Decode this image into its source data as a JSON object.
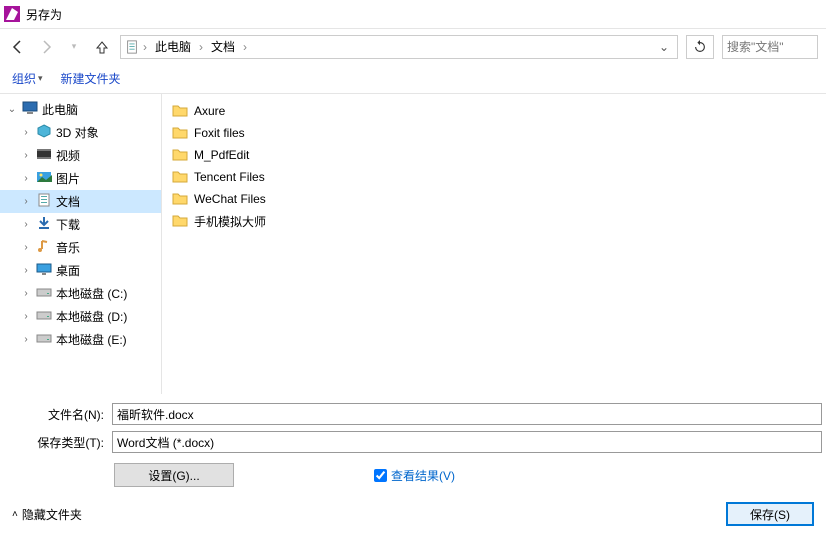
{
  "window": {
    "title": "另存为"
  },
  "breadcrumb": {
    "items": [
      "此电脑",
      "文档"
    ]
  },
  "search": {
    "placeholder": "搜索\"文档\""
  },
  "toolbar": {
    "organize": "组织",
    "new_folder": "新建文件夹"
  },
  "tree": {
    "items": [
      {
        "label": "此电脑",
        "icon": "pc",
        "expanded": true,
        "level": 0
      },
      {
        "label": "3D 对象",
        "icon": "3d",
        "level": 1
      },
      {
        "label": "视频",
        "icon": "video",
        "level": 1
      },
      {
        "label": "图片",
        "icon": "image",
        "level": 1
      },
      {
        "label": "文档",
        "icon": "doc",
        "level": 1,
        "selected": true
      },
      {
        "label": "下载",
        "icon": "download",
        "level": 1
      },
      {
        "label": "音乐",
        "icon": "music",
        "level": 1
      },
      {
        "label": "桌面",
        "icon": "desktop",
        "level": 1
      },
      {
        "label": "本地磁盘 (C:)",
        "icon": "disk",
        "level": 1
      },
      {
        "label": "本地磁盘 (D:)",
        "icon": "disk",
        "level": 1
      },
      {
        "label": "本地磁盘 (E:)",
        "icon": "disk",
        "level": 1
      }
    ]
  },
  "files": [
    {
      "name": "Axure"
    },
    {
      "name": "Foxit files"
    },
    {
      "name": "M_PdfEdit"
    },
    {
      "name": "Tencent Files"
    },
    {
      "name": "WeChat Files"
    },
    {
      "name": "手机模拟大师"
    }
  ],
  "filename": {
    "label": "文件名(N):",
    "value": "福昕软件.docx"
  },
  "filetype": {
    "label": "保存类型(T):",
    "value": "Word文档 (*.docx)"
  },
  "settings_btn": "设置(G)...",
  "view_result": {
    "label": "查看结果(V)",
    "checked": true
  },
  "footer": {
    "hide_folders": "隐藏文件夹",
    "save": "保存(S)"
  }
}
